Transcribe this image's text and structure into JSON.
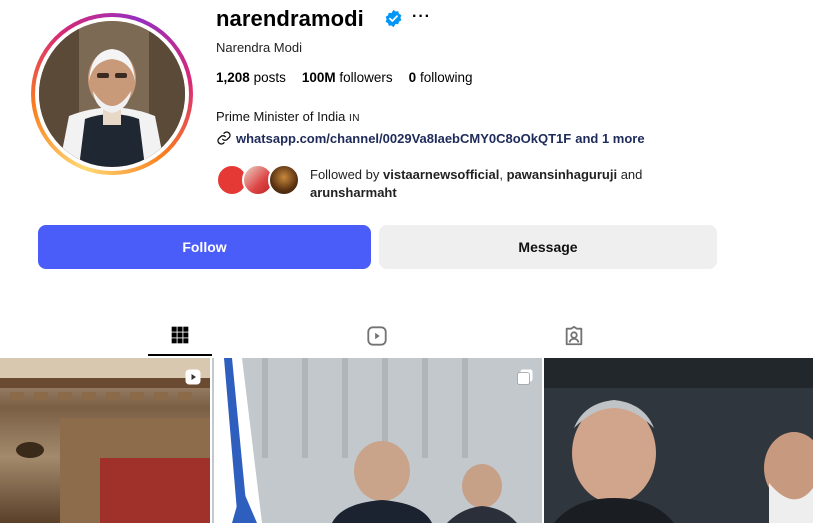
{
  "profile": {
    "username": "narendramodi",
    "full_name": "Narendra Modi",
    "stats": {
      "posts_count": "1,208",
      "posts_label": "posts",
      "followers_count": "100M",
      "followers_label": "followers",
      "following_count": "0",
      "following_label": "following"
    },
    "bio": {
      "text": "Prime Minister of India",
      "tag": "IN"
    },
    "link": {
      "text": "whatsapp.com/channel/0029Va8IaebCMY0C8oOkQT1F",
      "more": "and 1 more"
    },
    "followed_by": {
      "prefix": "Followed by",
      "user1": "vistaarnewsofficial",
      "user2": "pawansinhaguruji",
      "joiner": "and",
      "user3": "arunsharmaht"
    }
  },
  "actions": {
    "follow_label": "Follow",
    "message_label": "Message"
  },
  "tabs": [
    "posts-grid-icon",
    "reels-icon",
    "tagged-icon"
  ],
  "colors": {
    "follow_button": "#4a5df9",
    "message_button": "#efefef",
    "verified_badge": "#0095f6"
  }
}
